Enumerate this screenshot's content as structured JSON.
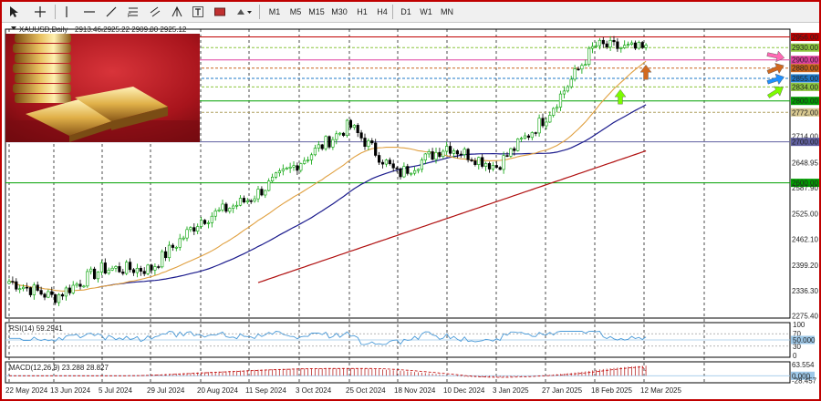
{
  "toolbar": {
    "timeframes": [
      "M1",
      "M5",
      "M15",
      "M30",
      "H1",
      "H4",
      "D1",
      "W1",
      "MN"
    ]
  },
  "header": {
    "symbol_label": "XAUUSD,Daily",
    "ohlc": "2913.46 2925.22 2909.00 2925.12"
  },
  "main": {
    "y_ticks": [
      {
        "v": 2956.0,
        "label": "2956.00",
        "hl": "#c00000"
      },
      {
        "v": 2930.0,
        "label": "2930.00",
        "hl": "#8cc63f"
      },
      {
        "v": 2900.0,
        "label": "2900.00",
        "hl": "#e040a0"
      },
      {
        "v": 2880.0,
        "label": "2880.00",
        "hl": "#c8641e"
      },
      {
        "v": 2855.0,
        "label": "2855.00",
        "hl": "#1e78c8"
      },
      {
        "v": 2834.0,
        "label": "2834.00",
        "hl": "#8cc63f"
      },
      {
        "v": 2800.0,
        "label": "2800.00",
        "hl": "#00a000"
      },
      {
        "v": 2772.0,
        "label": "2772.00",
        "hl": "#d8c890"
      },
      {
        "v": 2714.0,
        "label": "2714.00",
        "hl": ""
      },
      {
        "v": 2700.0,
        "label": "2700.00",
        "hl": "#6060a0"
      },
      {
        "v": 2648.95,
        "label": "2648.95",
        "hl": ""
      },
      {
        "v": 2600.0,
        "label": "2600.00",
        "hl": "#00a000"
      },
      {
        "v": 2587.9,
        "label": "2587.90",
        "hl": ""
      },
      {
        "v": 2525.0,
        "label": "2525.00",
        "hl": ""
      },
      {
        "v": 2462.1,
        "label": "2462.10",
        "hl": ""
      },
      {
        "v": 2399.2,
        "label": "2399.20",
        "hl": ""
      },
      {
        "v": 2336.3,
        "label": "2336.30",
        "hl": ""
      },
      {
        "v": 2275.4,
        "label": "2275.40",
        "hl": ""
      }
    ],
    "levels": [
      {
        "v": 2956.0,
        "color": "#c00000",
        "style": "solid"
      },
      {
        "v": 2930.0,
        "color": "#8cc63f",
        "style": "dash"
      },
      {
        "v": 2900.0,
        "color": "#e040a0",
        "style": "solid"
      },
      {
        "v": 2880.0,
        "color": "#c8641e",
        "style": "dash"
      },
      {
        "v": 2855.0,
        "color": "#1e78c8",
        "style": "dash"
      },
      {
        "v": 2834.0,
        "color": "#8cc63f",
        "style": "dash"
      },
      {
        "v": 2800.0,
        "color": "#00a000",
        "style": "solid"
      },
      {
        "v": 2772.0,
        "color": "#b0a060",
        "style": "dash"
      },
      {
        "v": 2700.0,
        "color": "#6060a0",
        "style": "solid"
      },
      {
        "v": 2600.0,
        "color": "#00a000",
        "style": "solid"
      }
    ],
    "date_labels": [
      "22 May 2024",
      "13 Jun 2024",
      "5 Jul 2024",
      "29 Jul 2024",
      "20 Aug 2024",
      "11 Sep 2024",
      "3 Oct 2024",
      "25 Oct 2024",
      "18 Nov 2024",
      "10 Dec 2024",
      "3 Jan 2025",
      "27 Jan 2025",
      "18 Feb 2025",
      "12 Mar 2025"
    ]
  },
  "indicators": {
    "rsi": {
      "label": "RSI(14) 59.2941",
      "ticks": [
        {
          "v": 100,
          "label": "100",
          "hl": ""
        },
        {
          "v": 70,
          "label": "70",
          "hl": ""
        },
        {
          "v": 50,
          "label": "50.000",
          "hl": "#9ec8e8"
        },
        {
          "v": 30,
          "label": "30",
          "hl": ""
        },
        {
          "v": 0,
          "label": "0",
          "hl": ""
        }
      ],
      "last": 59.2941
    },
    "macd": {
      "label": "MACD(12,26,9) 23.288 28.827",
      "ticks": [
        {
          "v": 63.554,
          "label": "63.554",
          "hl": ""
        },
        {
          "v": 0,
          "label": "0.000",
          "hl": "#9ec8e8"
        },
        {
          "v": -28.457,
          "label": "-28.457",
          "hl": ""
        }
      ],
      "macd_last": 23.288,
      "signal_last": 28.827
    }
  },
  "colors": {
    "bull": "#00a000",
    "bear": "#000000",
    "ma_fast": "#e0a040",
    "ma_mid": "#1a1a8c",
    "ma_slow": "#b01010",
    "rsi_line": "#4a9ad8",
    "macd_hist": "#c04040",
    "macd_signal": "#c00000",
    "frame": "#c00000",
    "arrow_pink": "#ff69b4",
    "arrow_orange": "#d2691e",
    "arrow_blue": "#1e90ff",
    "arrow_green": "#7cfc00"
  },
  "arrows": [
    {
      "name": "pink-arrow-icon",
      "color": "#ff69b4"
    },
    {
      "name": "orange-arrow-icon",
      "color": "#d2691e"
    },
    {
      "name": "blue-arrow-icon",
      "color": "#1e90ff"
    },
    {
      "name": "green-arrow-icon",
      "color": "#7cfc00"
    },
    {
      "name": "chart-green-up-arrow-icon",
      "color": "#7cfc00"
    },
    {
      "name": "chart-orange-up-arrow-icon",
      "color": "#d2691e"
    }
  ],
  "chart_data": {
    "type": "candlestick",
    "series": [
      {
        "name": "XAUUSD",
        "keypoints": [
          {
            "x": "22 May 2024",
            "close": 2360
          },
          {
            "x": "13 Jun 2024",
            "close": 2320
          },
          {
            "x": "5 Jul 2024",
            "close": 2390
          },
          {
            "x": "29 Jul 2024",
            "close": 2390
          },
          {
            "x": "20 Aug 2024",
            "close": 2510
          },
          {
            "x": "11 Sep 2024",
            "close": 2560
          },
          {
            "x": "3 Oct 2024",
            "close": 2650
          },
          {
            "x": "25 Oct 2024",
            "close": 2740
          },
          {
            "x": "18 Nov 2024",
            "close": 2620
          },
          {
            "x": "10 Dec 2024",
            "close": 2690
          },
          {
            "x": "3 Jan 2025",
            "close": 2640
          },
          {
            "x": "27 Jan 2025",
            "close": 2760
          },
          {
            "x": "18 Feb 2025",
            "close": 2935
          },
          {
            "x": "12 Mar 2025",
            "close": 2925
          }
        ]
      }
    ],
    "ylim": [
      2270,
      2975
    ]
  }
}
